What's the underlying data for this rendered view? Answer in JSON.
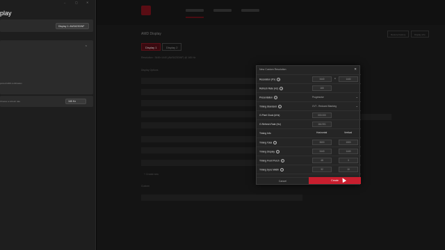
{
  "left_window": {
    "title": "play",
    "controls": [
      "–",
      "▢",
      "✕"
    ],
    "display_select": "Display 1: AW3423DWF",
    "setting_row": "Lorem ipsum connection",
    "panel_lines": [
      "",
      "",
      "",
      "ported HDR certification",
      ""
    ],
    "refresh_row": "Choose a refresh rate",
    "refresh_value": "165 Hz"
  },
  "app": {
    "page_title": "AMD Display",
    "tabs": [
      "Display 1",
      "Display 2"
    ],
    "toolbar_buttons": [
      "Restore Factory",
      "Display Info"
    ],
    "subtitle": "Resolution : 3440×1440 (AW3423DWF) @ 165 Hz",
    "section1": "Display Options",
    "section2": "Custom",
    "link": "+ Create new"
  },
  "modal": {
    "title": "New Custom Resolution",
    "close": "✕",
    "resolution": {
      "label": "Resolution (Px)",
      "w": "3440",
      "x": "x",
      "h": "1440"
    },
    "refresh": {
      "label": "Refresh Rate (Hz)",
      "value": "165"
    },
    "presentation": {
      "label": "Presentation",
      "value": "Progressive"
    },
    "timing_standard": {
      "label": "Timing Standard",
      "value": "CVT - Reduced Blanking"
    },
    "pixel_clock": {
      "label": "G.Pixel Clock (kHz)",
      "value": "000.000"
    },
    "g_refresh": {
      "label": "G.Refresh Rate (Hz)",
      "value": "164.901"
    },
    "timing_info": {
      "label": "Timing Info",
      "h": "Horizontal",
      "v": "Vertical"
    },
    "timing_total": {
      "label": "Timing Total",
      "h": "3600",
      "v": "1500"
    },
    "timing_display": {
      "label": "Timing Display",
      "h": "3440",
      "v": "1440"
    },
    "timing_front": {
      "label": "Timing Front Porch",
      "h": "48",
      "v": "3"
    },
    "timing_sync": {
      "label": "Timing Sync Width",
      "h": "32",
      "v": "10"
    },
    "timing_polarity": {
      "label": "Timing Polarity",
      "h": "Positive",
      "v": "Negative"
    },
    "cancel": "Cancel",
    "create": "Create"
  },
  "colors": {
    "accent": "#c81e2e"
  }
}
